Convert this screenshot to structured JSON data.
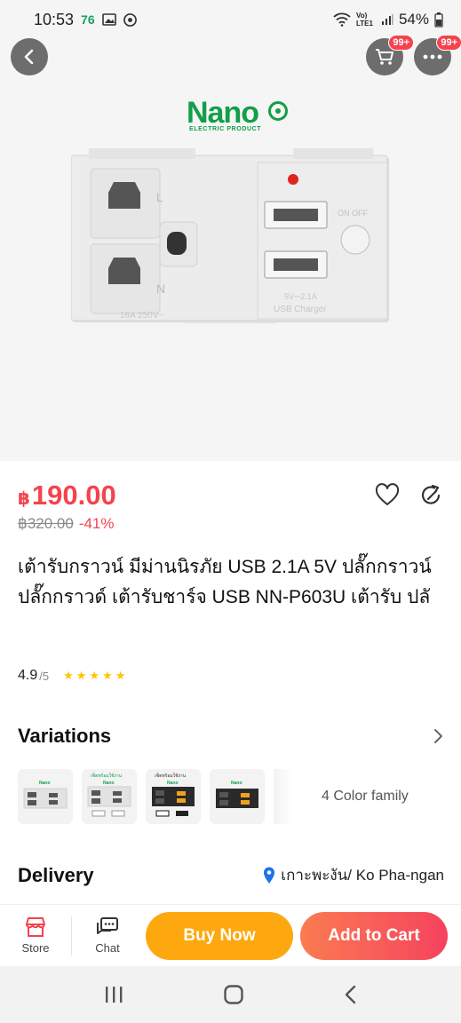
{
  "status_bar": {
    "time": "10:53",
    "data_indicator": "76",
    "network": "Vo) LTE1",
    "battery": "54%"
  },
  "header": {
    "cart_badge": "99+",
    "more_badge": "99+"
  },
  "hero": {
    "brand_name": "Nano",
    "brand_tagline": "ELECTRIC PRODUCT",
    "socket_rating": "16A 250V~",
    "usb_rating": "5V⎓2.1A",
    "usb_label": "USB Charger",
    "switch_label": "ON OFF"
  },
  "price": {
    "currency": "฿",
    "current": "190.00",
    "original": "฿320.00",
    "discount": "-41%"
  },
  "product": {
    "title": "เต้ารับกราวน์ มีม่านนิรภัย USB 2.1A 5V ปลั๊กกราวน์ ปลั๊กกราวด์ เต้ารับชาร์จ USB NN-P603U เต้ารับ ปลั"
  },
  "rating": {
    "value": "4.9",
    "max": "/5",
    "stars": 5
  },
  "variations": {
    "title": "Variations",
    "color_family": "4 Color family",
    "thumbs": [
      {
        "style": "white"
      },
      {
        "style": "white-labeled"
      },
      {
        "style": "black-labeled"
      },
      {
        "style": "black"
      }
    ],
    "thumb_text": {
      "brand": "Nano",
      "set_label": "เซ็ตพร้อมใช้งาน"
    }
  },
  "delivery": {
    "title": "Delivery",
    "location": "เกาะพะงัน/ Ko Pha-ngan"
  },
  "bottom_bar": {
    "store_label": "Store",
    "chat_label": "Chat",
    "buy_now_label": "Buy Now",
    "add_to_cart_label": "Add to Cart"
  },
  "colors": {
    "price_red": "#f5434d",
    "buy_now_orange": "#fca80e",
    "brand_green": "#139e4a"
  }
}
